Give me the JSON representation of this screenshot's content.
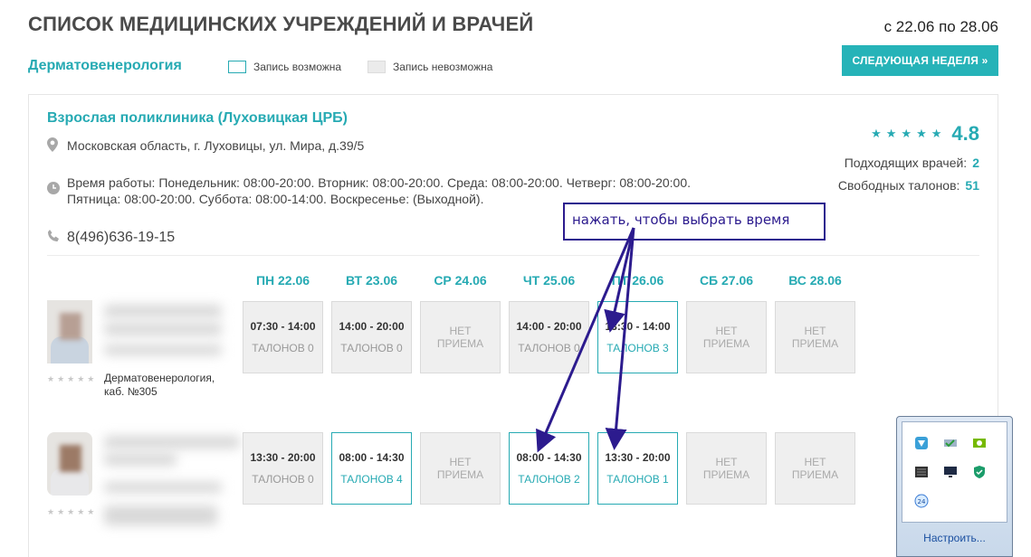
{
  "header": {
    "title": "СПИСОК МЕДИЦИНСКИХ УЧРЕЖДЕНИЙ И ВРАЧЕЙ",
    "week_range": "с 22.06 по 28.06",
    "specialty": "Дерматовенерология",
    "legend_available": "Запись возможна",
    "legend_unavailable": "Запись невозможна",
    "next_week_label": "СЛЕДУЮЩАЯ НЕДЕЛЯ »"
  },
  "clinic": {
    "name": "Взрослая поликлиника (Луховицкая ЦРБ)",
    "address": "Московская область, г. Луховицы, ул. Мира, д.39/5",
    "hours_line1": "Время работы: Понедельник: 08:00-20:00. Вторник: 08:00-20:00. Среда: 08:00-20:00. Четверг: 08:00-20:00.",
    "hours_line2": "Пятница: 08:00-20:00. Суббота: 08:00-14:00. Воскресенье: (Выходной).",
    "phone": "8(496)636-19-15",
    "stars": "★★★★★",
    "rating": "4.8",
    "doctors_label": "Подходящих врачей:",
    "doctors_count": "2",
    "tickets_label": "Свободных талонов:",
    "tickets_count": "51"
  },
  "days": [
    "ПН 22.06",
    "ВТ 23.06",
    "СР 24.06",
    "ЧТ 25.06",
    "ПТ 26.06",
    "СБ 27.06",
    "ВС 28.06"
  ],
  "doctors": [
    {
      "stars": "★★★★★",
      "specialty_line1": "Дерматовенерология,",
      "specialty_line2": "каб. №305",
      "slots": [
        {
          "state": "unavail",
          "time": "07:30 - 14:00",
          "tickets": "ТАЛОНОВ 0"
        },
        {
          "state": "unavail",
          "time": "14:00 - 20:00",
          "tickets": "ТАЛОНОВ 0"
        },
        {
          "state": "none",
          "line1": "НЕТ",
          "line2": "ПРИЕМА"
        },
        {
          "state": "unavail",
          "time": "14:00 - 20:00",
          "tickets": "ТАЛОНОВ 0"
        },
        {
          "state": "avail",
          "time": "13:30 - 14:00",
          "tickets": "ТАЛОНОВ 3"
        },
        {
          "state": "none",
          "line1": "НЕТ",
          "line2": "ПРИЕМА"
        },
        {
          "state": "none",
          "line1": "НЕТ",
          "line2": "ПРИЕМА"
        }
      ]
    },
    {
      "stars": "★★★★★",
      "slots": [
        {
          "state": "unavail",
          "time": "13:30 - 20:00",
          "tickets": "ТАЛОНОВ 0"
        },
        {
          "state": "avail",
          "time": "08:00 - 14:30",
          "tickets": "ТАЛОНОВ 4"
        },
        {
          "state": "none",
          "line1": "НЕТ",
          "line2": "ПРИЕМА"
        },
        {
          "state": "avail",
          "time": "08:00 - 14:30",
          "tickets": "ТАЛОНОВ 2"
        },
        {
          "state": "avail",
          "time": "13:30 - 20:00",
          "tickets": "ТАЛОНОВ 1"
        },
        {
          "state": "none",
          "line1": "НЕТ",
          "line2": "ПРИЕМА"
        },
        {
          "state": "none",
          "line1": "НЕТ",
          "line2": "ПРИЕМА"
        }
      ]
    }
  ],
  "annotation": {
    "text": "нажать, чтобы выбрать время"
  },
  "tray": {
    "customize_label": "Настроить...",
    "icons": [
      "app-icon",
      "network-icon",
      "nvidia-icon",
      "keyboard-icon",
      "monitor-icon",
      "shield-icon",
      "clock-24-icon"
    ]
  },
  "colors": {
    "accent": "#26aab3",
    "annotation": "#2c1b8e"
  }
}
